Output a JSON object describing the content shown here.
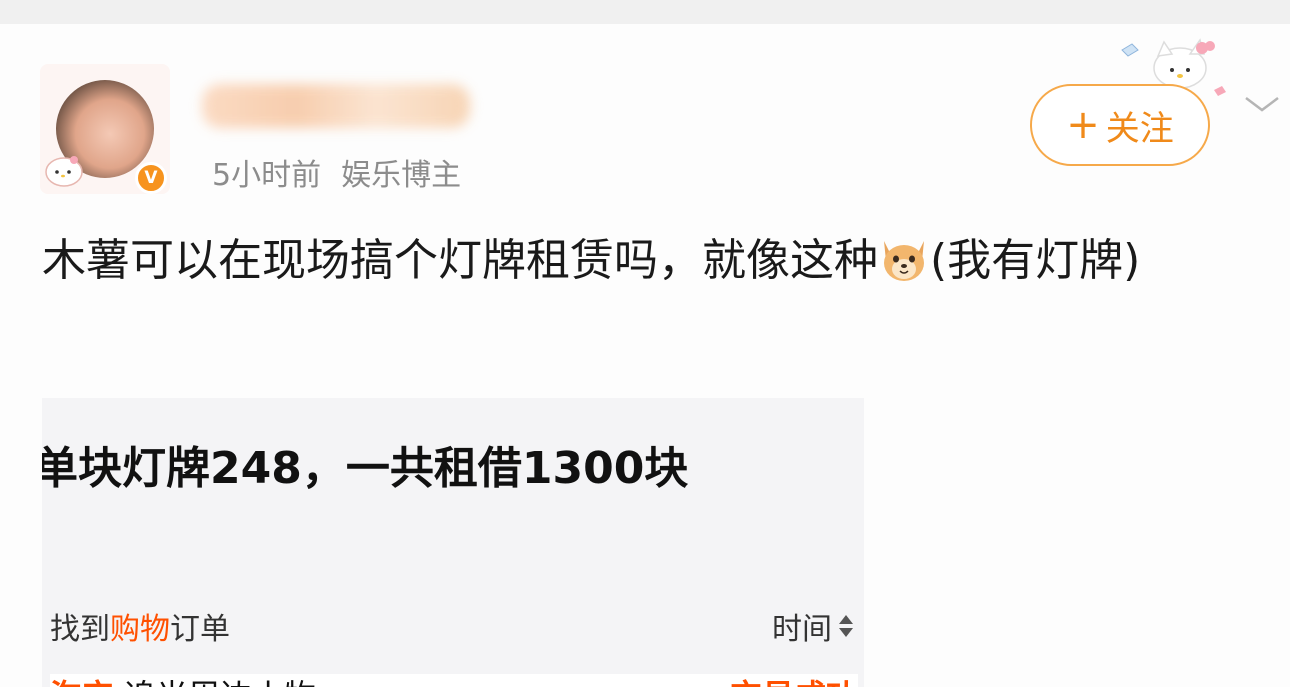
{
  "post": {
    "meta": {
      "time": "5小时前",
      "tag": "娱乐博主"
    },
    "follow_label": "关注",
    "text_before_emoji": "木薯可以在现场搞个灯牌租赁吗，就像这种",
    "text_after_emoji": "(我有灯牌)",
    "emoji": "dog-face"
  },
  "embed": {
    "headline": "单块灯牌248，一共租借1300块",
    "search_prefix": "找到",
    "search_highlight": "购物",
    "search_suffix": "订单",
    "time_label": "时间",
    "store_logo": "淘宝",
    "shop_name": "追光周边小物",
    "order_status": "交易成功"
  },
  "colors": {
    "accent_orange": "#f08a1a",
    "taobao_orange": "#ff5000",
    "meta_gray": "#8c8c8c"
  },
  "icons": [
    "verified-v-icon",
    "plus-icon",
    "chevron-down-icon",
    "hello-kitty-sticker",
    "sort-arrows-icon",
    "chevron-right-icon"
  ]
}
